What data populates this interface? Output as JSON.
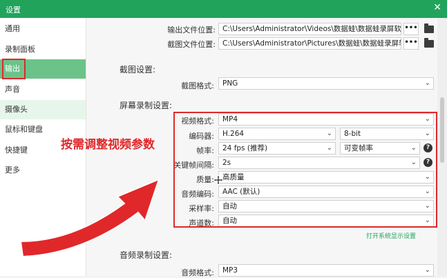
{
  "window": {
    "title": "设置",
    "close_icon": "close-icon"
  },
  "sidebar": {
    "items": [
      {
        "label": "通用"
      },
      {
        "label": "录制面板"
      },
      {
        "label": "输出"
      },
      {
        "label": "声音"
      },
      {
        "label": "摄像头"
      },
      {
        "label": "鼠标和键盘"
      },
      {
        "label": "快捷键"
      },
      {
        "label": "更多"
      }
    ],
    "active": "输出"
  },
  "output": {
    "video_path_label": "输出文件位置:",
    "video_path": "C:\\Users\\Administrator\\Videos\\数据蛙\\数据蛙录屏软件",
    "shot_path_label": "截图文件位置:",
    "shot_path": "C:\\Users\\Administrator\\Pictures\\数据蛙\\数据蛙录屏软件",
    "browse_label": "•••"
  },
  "screenshot": {
    "section_title": "截图设置:",
    "format_label": "截图格式:",
    "format_value": "PNG"
  },
  "screen_recording": {
    "section_title": "屏幕录制设置:",
    "video_format_label": "视频格式:",
    "video_format": "MP4",
    "encoder_label": "编码器:",
    "encoder": "H.264",
    "bit_depth": "8-bit",
    "framerate_label": "帧率:",
    "framerate": "24 fps (推荐)",
    "framerate_mode": "可变帧率",
    "keyframe_label": "关键帧间隔:",
    "keyframe": "2s",
    "quality_label": "质量:",
    "quality": "高质量",
    "audio_codec_label": "音频编码:",
    "audio_codec": "AAC (默认)",
    "samplerate_label": "采样率:",
    "samplerate": "自动",
    "channels_label": "声道数:",
    "channels": "自动",
    "help_label": "?"
  },
  "link_text": "打开系统显示设置",
  "audio_recording": {
    "section_title": "音频录制设置:",
    "format_label": "音频格式:",
    "format_value": "MP3"
  },
  "annotation": {
    "text": "按需调整视频参数",
    "color": "#e0282a"
  },
  "colors": {
    "accent": "#22a35c",
    "active_item": "#6cc38a",
    "highlight": "#e0282a"
  }
}
